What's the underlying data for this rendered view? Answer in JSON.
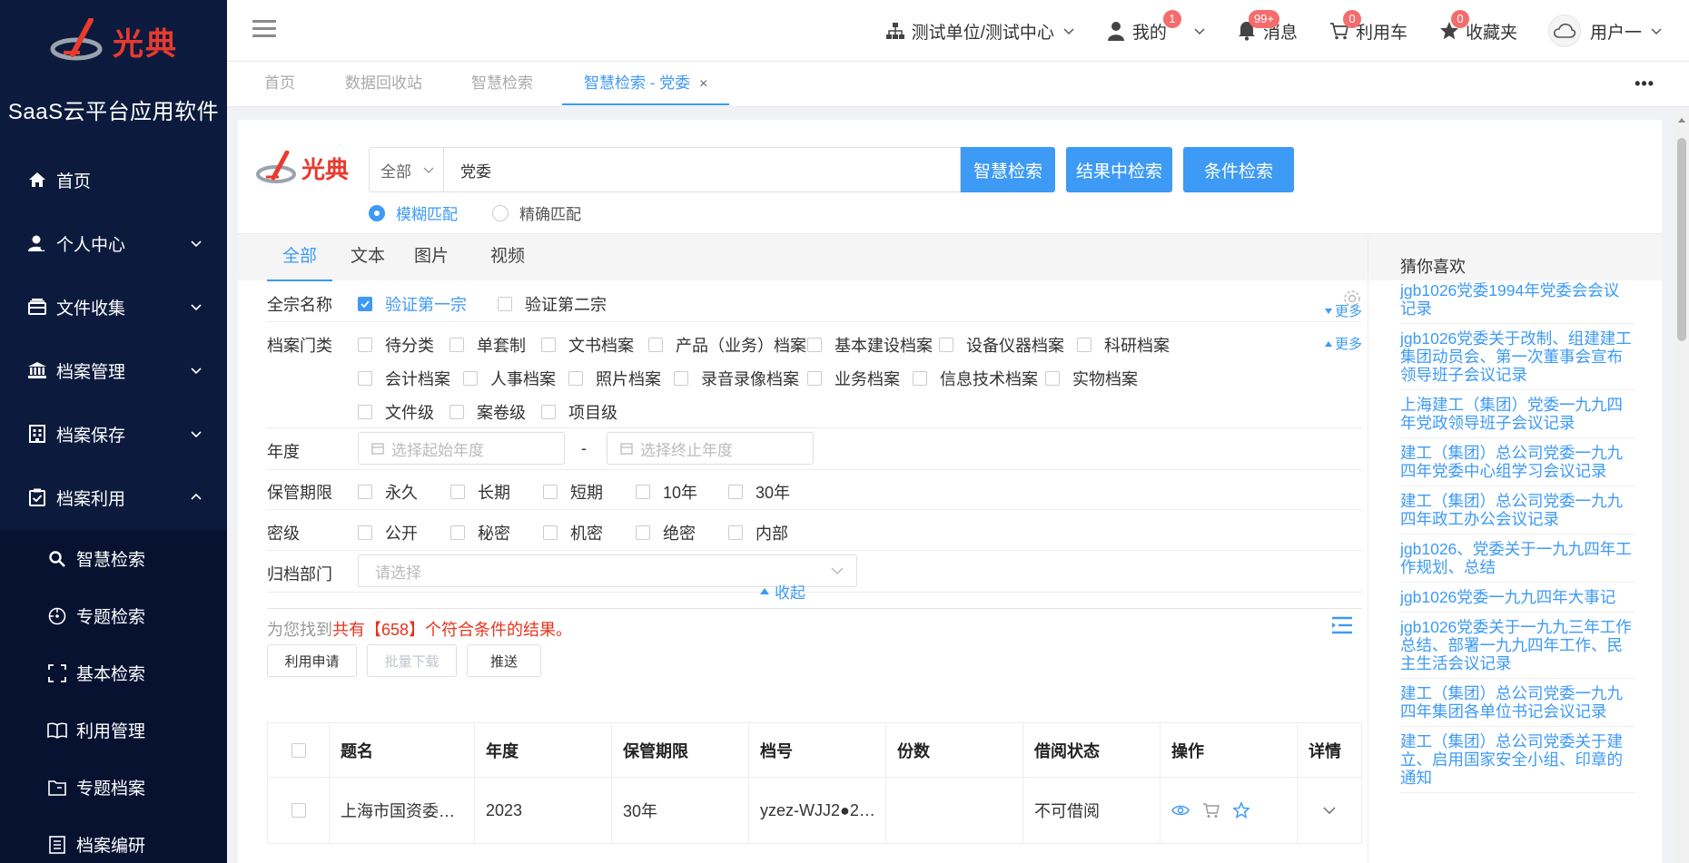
{
  "sidebar": {
    "app_name": "SaaS云平台应用软件",
    "logo_text": "光典",
    "items": [
      {
        "label": "首页",
        "icon": "home-icon"
      },
      {
        "label": "个人中心",
        "icon": "user-icon"
      },
      {
        "label": "文件收集",
        "icon": "inbox-icon"
      },
      {
        "label": "档案管理",
        "icon": "bank-icon"
      },
      {
        "label": "档案保存",
        "icon": "building-icon"
      },
      {
        "label": "档案利用",
        "icon": "clipboard-check-icon"
      }
    ],
    "sub_items": [
      {
        "label": "智慧检索",
        "icon": "search-icon"
      },
      {
        "label": "专题检索",
        "icon": "compass-icon"
      },
      {
        "label": "基本检索",
        "icon": "scan-icon"
      },
      {
        "label": "利用管理",
        "icon": "book-icon"
      },
      {
        "label": "专题档案",
        "icon": "folder-icon"
      },
      {
        "label": "档案编研",
        "icon": "document-icon"
      }
    ]
  },
  "header": {
    "org": "测试单位/测试中心",
    "mine": "我的",
    "mine_badge": "1",
    "messages": "消息",
    "messages_badge": "99+",
    "cart": "利用车",
    "cart_badge": "0",
    "favorites": "收藏夹",
    "favorites_badge": "0",
    "user": "用户一"
  },
  "tabs": {
    "items": [
      "首页",
      "数据回收站",
      "智慧检索"
    ],
    "active": "智慧检索 - 党委",
    "close": "×",
    "more": "•••"
  },
  "search": {
    "logo_text": "光典",
    "scope": "全部",
    "query": "党委",
    "btn_smart": "智慧检索",
    "btn_in_results": "结果中检索",
    "btn_condition": "条件检索",
    "fuzzy": "模糊匹配",
    "exact": "精确匹配"
  },
  "type_tabs": [
    "全部",
    "文本",
    "图片",
    "视频"
  ],
  "filters": {
    "fonds_label": "全宗名称",
    "fonds": [
      {
        "label": "验证第一宗",
        "checked": true
      },
      {
        "label": "验证第二宗",
        "checked": false
      }
    ],
    "more": "更多",
    "category_label": "档案门类",
    "categories_row1": [
      "待分类",
      "单套制",
      "文书档案",
      "产品（业务）档案",
      "基本建设档案",
      "设备仪器档案",
      "科研档案"
    ],
    "categories_row2": [
      "会计档案",
      "人事档案",
      "照片档案",
      "录音录像档案",
      "业务档案",
      "信息技术档案",
      "实物档案"
    ],
    "categories_row3": [
      "文件级",
      "案卷级",
      "项目级"
    ],
    "year_label": "年度",
    "year_start_placeholder": "选择起始年度",
    "year_sep": "-",
    "year_end_placeholder": "选择终止年度",
    "retention_label": "保管期限",
    "retention": [
      "永久",
      "长期",
      "短期",
      "10年",
      "30年"
    ],
    "secret_label": "密级",
    "secret": [
      "公开",
      "秘密",
      "机密",
      "绝密",
      "内部"
    ],
    "dept_label": "归档部门",
    "dept_placeholder": "请选择",
    "collapse": "收起"
  },
  "results": {
    "prefix": "为您找到",
    "highlight": "共有【658】个符合条件的结果。",
    "btn_apply": "利用申请",
    "btn_download": "批量下载",
    "btn_push": "推送"
  },
  "table": {
    "headers": [
      "题名",
      "年度",
      "保管期限",
      "档号",
      "份数",
      "借阅状态",
      "操作",
      "详情"
    ],
    "rows": [
      {
        "title": "上海市国资委…",
        "year": "2023",
        "retention": "30年",
        "code": "yzez-WJJ2●2…",
        "count": "",
        "status": "不可借阅"
      }
    ]
  },
  "guess": {
    "title": "猜你喜欢",
    "items": [
      "jgb1026党委1994年党委会会议记录",
      "jgb1026党委关于改制、组建建工集团动员会、第一次董事会宣布领导班子会议记录",
      "上海建工（集团）党委一九九四年党政领导班子会议记录",
      "建工（集团）总公司党委一九九四年党委中心组学习会议记录",
      "建工（集团）总公司党委一九九四年政工办公会议记录",
      "jgb1026、党委关于一九九四年工作规划、总结",
      "jgb1026党委一九九四年大事记",
      "jgb1026党委关于一九九三年工作总结、部署一九九四年工作、民主生活会议记录",
      "建工（集团）总公司党委一九九四年集团各单位书记会议记录",
      "建工（集团）总公司党委关于建立、启用国家安全小组、印章的通知"
    ]
  },
  "colors": {
    "primary": "#3d9af5",
    "sidebar": "#0c1b3d",
    "badge": "#f56c6c",
    "highlight": "#e8331c"
  }
}
